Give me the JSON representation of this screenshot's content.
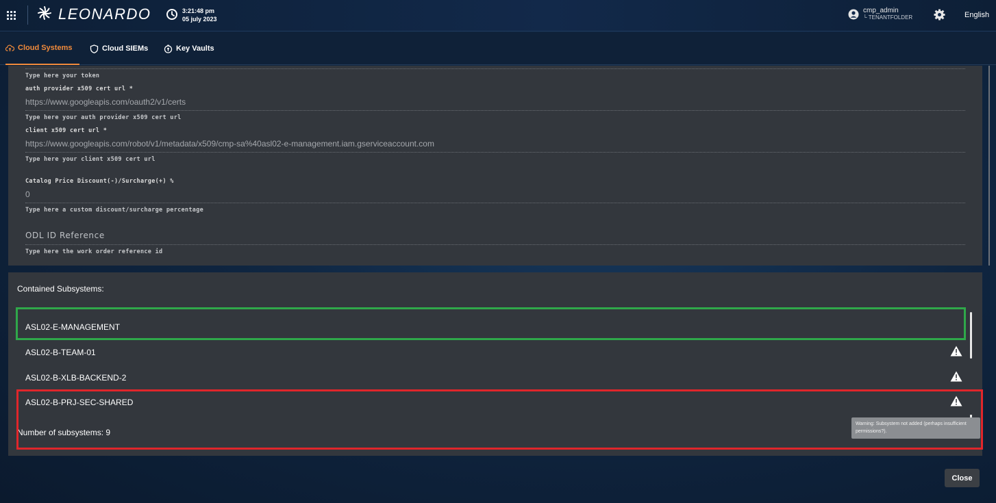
{
  "header": {
    "app_name": "LEONARDO",
    "time": "3:21:48 pm",
    "date": "05 july 2023",
    "user": "cmp_admin",
    "tenant": "└ TENANTFOLDER",
    "language": "English",
    "icons": [
      "apps-grid-icon",
      "leonardo-logo-icon",
      "clock-icon",
      "user-icon",
      "settings-icon"
    ]
  },
  "tabs": [
    {
      "label": "Cloud Systems",
      "icon": "cloud-upload-icon",
      "active": true
    },
    {
      "label": "Cloud SIEMs",
      "icon": "shield-icon",
      "active": false
    },
    {
      "label": "Key Vaults",
      "icon": "key-vault-icon",
      "active": false
    }
  ],
  "form": {
    "token_hint": "Type here your token",
    "auth_provider_label": "auth provider x509 cert url *",
    "auth_provider_value": "https://www.googleapis.com/oauth2/v1/certs",
    "auth_provider_hint": "Type here your auth provider x509 cert url",
    "client_cert_label": "client x509 cert url *",
    "client_cert_value": "https://www.googleapis.com/robot/v1/metadata/x509/cmp-sa%40asl02-e-management.iam.gserviceaccount.com",
    "client_cert_hint": "Type here your client x509 cert url",
    "discount_label": "Catalog Price Discount(-)/Surcharge(+) %",
    "discount_value": "0",
    "discount_hint": "Type here a custom discount/surcharge percentage",
    "odl_placeholder": "ODL ID Reference",
    "odl_hint": "Type here the work order reference id"
  },
  "subsystems": {
    "title": "Contained Subsystems:",
    "items": [
      {
        "name": "ASL02-E-MANAGEMENT",
        "warning": false
      },
      {
        "name": "ASL02-B-TEAM-01",
        "warning": true
      },
      {
        "name": "ASL02-B-XLB-BACKEND-2",
        "warning": true
      },
      {
        "name": "ASL02-B-PRJ-SEC-SHARED",
        "warning": true
      }
    ],
    "count_label": "Number of subsystems: 9",
    "tooltip": "Warning: Subsystem not added (perhaps insufficient permissions?)."
  },
  "actions": {
    "close_label": "Close"
  },
  "colors": {
    "accent": "#f28b3b",
    "panel": "#33373d",
    "highlight_ok": "#2fa84a",
    "highlight_error": "#e0262b"
  }
}
